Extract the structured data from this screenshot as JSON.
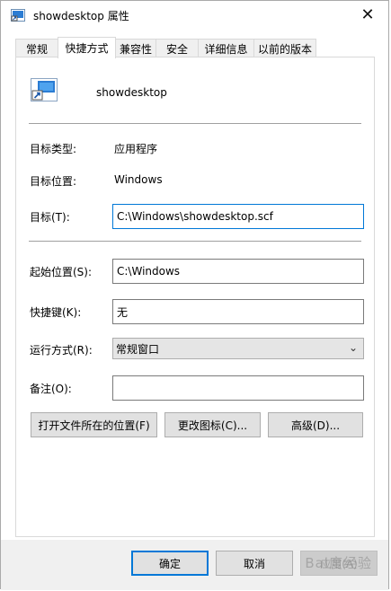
{
  "window": {
    "title": "showdesktop 属性",
    "close_glyph": "✕"
  },
  "tabs": [
    {
      "label": "常规"
    },
    {
      "label": "快捷方式"
    },
    {
      "label": "兼容性"
    },
    {
      "label": "安全"
    },
    {
      "label": "详细信息"
    },
    {
      "label": "以前的版本"
    }
  ],
  "shortcut": {
    "name": "showdesktop",
    "target_type_label": "目标类型:",
    "target_type_value": "应用程序",
    "target_location_label": "目标位置:",
    "target_location_value": "Windows",
    "target_label": "目标(T):",
    "target_value": "C:\\Windows\\showdesktop.scf",
    "start_in_label": "起始位置(S):",
    "start_in_value": "C:\\Windows",
    "hotkey_label": "快捷键(K):",
    "hotkey_value": "无",
    "run_label": "运行方式(R):",
    "run_value": "常规窗口",
    "comment_label": "备注(O):",
    "comment_value": ""
  },
  "actions": {
    "open_location": "打开文件所在的位置(F)",
    "change_icon": "更改图标(C)...",
    "advanced": "高级(D)..."
  },
  "footer": {
    "ok": "确定",
    "cancel": "取消",
    "apply": "应用(A)"
  },
  "watermark": "Bai度经验",
  "colors": {
    "focus_blue": "#0078d7",
    "button_bg": "#e1e1e1",
    "footer_bg": "#f0f0f0"
  }
}
